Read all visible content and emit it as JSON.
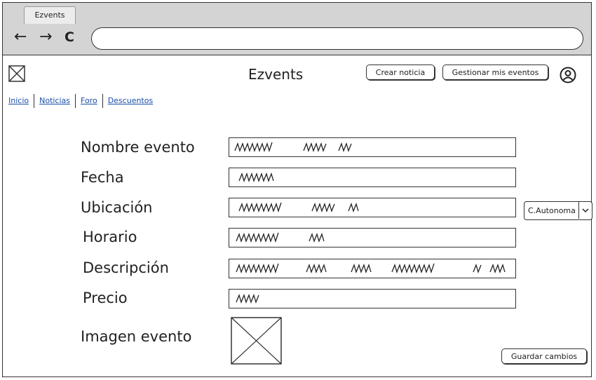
{
  "browser": {
    "tab_title": "Ezvents",
    "back_icon": "←",
    "forward_icon": "→",
    "reload_icon": "C",
    "url": ""
  },
  "header": {
    "app_title": "Ezvents",
    "create_news_label": "Crear noticia",
    "manage_events_label": "Gestionar mis eventos"
  },
  "nav": {
    "items": [
      {
        "label": "Inicio"
      },
      {
        "label": "Noticias"
      },
      {
        "label": "Foro"
      },
      {
        "label": "Descuentos"
      }
    ]
  },
  "form": {
    "fields": [
      {
        "label": "Nombre evento"
      },
      {
        "label": "Fecha"
      },
      {
        "label": "Ubicación"
      },
      {
        "label": "Horario"
      },
      {
        "label": "Descripción"
      },
      {
        "label": "Precio"
      }
    ],
    "image_label": "Imagen evento",
    "location_select_value": "C.Autonoma",
    "save_label": "Guardar cambios"
  }
}
